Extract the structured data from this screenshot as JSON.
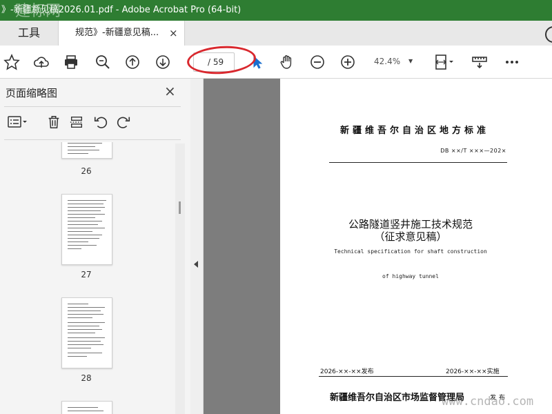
{
  "window": {
    "title": "》-新疆意见稿2026.01.pdf - Adobe Acrobat Pro (64-bit)",
    "watermark_top": "建标网"
  },
  "tabs": {
    "tools_label": "工具",
    "doc_label": "规范》-新疆意见稿...",
    "close_glyph": "×"
  },
  "toolbar": {
    "page_current": "",
    "page_total": "/ 59",
    "zoom_value": "42.4%"
  },
  "sidebar": {
    "title": "页面缩略图",
    "close_glyph": "×",
    "thumbnails": [
      {
        "page": "26"
      },
      {
        "page": "27"
      },
      {
        "page": "28"
      }
    ]
  },
  "document": {
    "standard_header": "新疆维吾尔自治区地方标准",
    "standard_code": "DB ××/T ×××—202×",
    "title": "公路隧道竖井施工技术规范",
    "subtitle": "（征求意见稿）",
    "english_title_line1": "Technical specification for shaft construction",
    "english_title_line2": "of highway tunnel",
    "publish_date": "2026-××-××发布",
    "implement_date": "2026-××-××实施",
    "issuer": "新疆维吾尔自治区市场监督管理局",
    "issue_word": "发布"
  },
  "watermark_bottom": "www.cndao.com",
  "colors": {
    "titlebar": "#2e7d32",
    "highlight_circle": "#d9282e",
    "doc_background": "#7d7d7d"
  }
}
